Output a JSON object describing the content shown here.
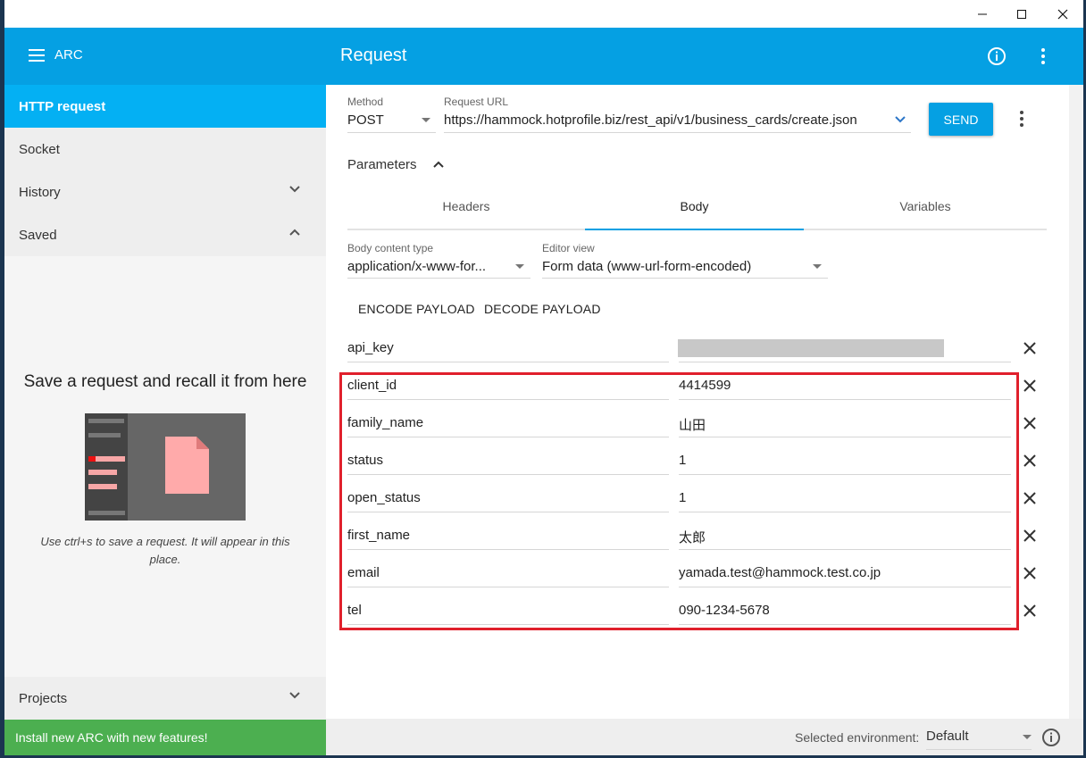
{
  "window": {
    "minimize": "—",
    "maximize": "☐",
    "close": "✕"
  },
  "app": {
    "name": "ARC",
    "page_title": "Request"
  },
  "sidebar": {
    "items": [
      {
        "label": "HTTP request"
      },
      {
        "label": "Socket"
      },
      {
        "label": "History"
      },
      {
        "label": "Saved"
      }
    ],
    "empty_title": "Save a request and recall it from here",
    "empty_hint": "Use ctrl+s to save a request. It will appear in this place.",
    "projects": "Projects",
    "install_banner": "Install new ARC with new features!"
  },
  "request": {
    "method_label": "Method",
    "method_value": "POST",
    "url_label": "Request URL",
    "url_value": "https://hammock.hotprofile.biz/rest_api/v1/business_cards/create.json",
    "send": "SEND",
    "parameters": "Parameters"
  },
  "tabs": [
    {
      "label": "Headers"
    },
    {
      "label": "Body"
    },
    {
      "label": "Variables"
    }
  ],
  "body": {
    "content_type_label": "Body content type",
    "content_type_value": "application/x-www-for...",
    "editor_view_label": "Editor view",
    "editor_view_value": "Form data (www-url-form-encoded)",
    "encode": "ENCODE PAYLOAD",
    "decode": "DECODE PAYLOAD"
  },
  "form_rows": [
    {
      "name": "api_key",
      "value": ""
    },
    {
      "name": "client_id",
      "value": "4414599"
    },
    {
      "name": "family_name",
      "value": "山田"
    },
    {
      "name": "status",
      "value": "1"
    },
    {
      "name": "open_status",
      "value": "1"
    },
    {
      "name": "first_name",
      "value": "太郎"
    },
    {
      "name": "email",
      "value": "yamada.test@hammock.test.co.jp"
    },
    {
      "name": "tel",
      "value": "090-1234-5678"
    }
  ],
  "footer": {
    "env_label": "Selected environment:",
    "env_value": "Default"
  },
  "colors": {
    "accent": "#05a0e3",
    "sidebar_active": "#04b0f3",
    "install_banner": "#4caf50",
    "highlight_box": "#e0202c"
  }
}
